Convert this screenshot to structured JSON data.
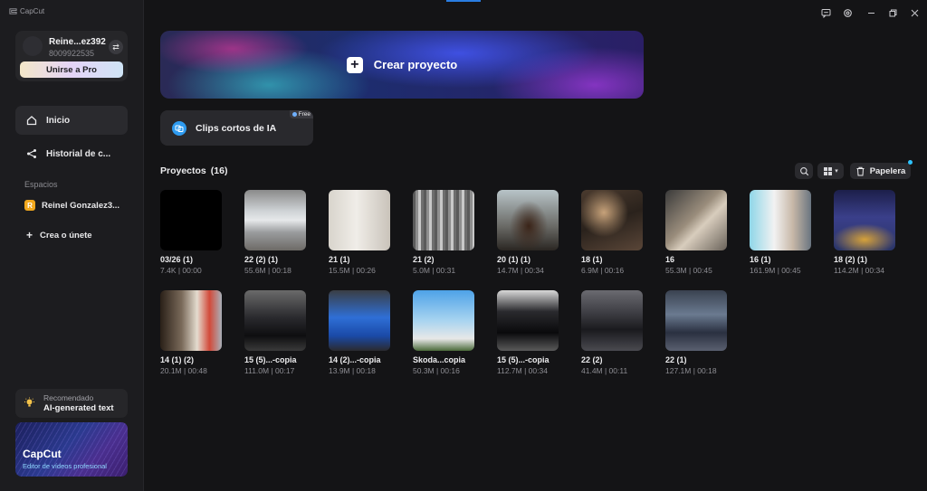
{
  "app": {
    "logo_text": "CapCut",
    "accent": "#2a7de1"
  },
  "user": {
    "name": "Reine...ez392",
    "id": "8009922535",
    "pro_label": "Unirse a Pro"
  },
  "nav": {
    "home": "Inicio",
    "history": "Historial de c..."
  },
  "spaces": {
    "title": "Espacios",
    "badge": "R",
    "space_name": "Reinel Gonzalez3...",
    "create": "Crea o únete"
  },
  "recommended": {
    "small": "Recomendado",
    "big": "AI-generated text"
  },
  "promo": {
    "title": "CapCut",
    "subtitle": "Editor de vídeos profesional"
  },
  "create": {
    "label": "Crear proyecto"
  },
  "clips": {
    "label": "Clips cortos de IA",
    "badge": "Free"
  },
  "projects": {
    "title": "Proyectos",
    "count": "(16)",
    "trash_label": "Papelera",
    "items": [
      {
        "name": "03/26 (1)",
        "meta": "7.4K | 00:00"
      },
      {
        "name": "22 (2) (1)",
        "meta": "55.6M | 00:18"
      },
      {
        "name": "21 (1)",
        "meta": "15.5M | 00:26"
      },
      {
        "name": "21 (2)",
        "meta": "5.0M | 00:31"
      },
      {
        "name": "20 (1) (1)",
        "meta": "14.7M | 00:34"
      },
      {
        "name": "18 (1)",
        "meta": "6.9M | 00:16"
      },
      {
        "name": "16",
        "meta": "55.3M | 00:45"
      },
      {
        "name": "16 (1)",
        "meta": "161.9M | 00:45"
      },
      {
        "name": "18 (2) (1)",
        "meta": "114.2M | 00:34"
      },
      {
        "name": "14 (1) (2)",
        "meta": "20.1M | 00:48"
      },
      {
        "name": "15 (5)...-copia",
        "meta": "111.0M | 00:17"
      },
      {
        "name": "14 (2)...-copia",
        "meta": "13.9M | 00:18"
      },
      {
        "name": "Skoda...copia",
        "meta": "50.3M | 00:16"
      },
      {
        "name": "15 (5)...-copia",
        "meta": "112.7M | 00:34"
      },
      {
        "name": "22 (2)",
        "meta": "41.4M | 00:11"
      },
      {
        "name": "22 (1)",
        "meta": "127.1M | 00:18"
      }
    ]
  }
}
